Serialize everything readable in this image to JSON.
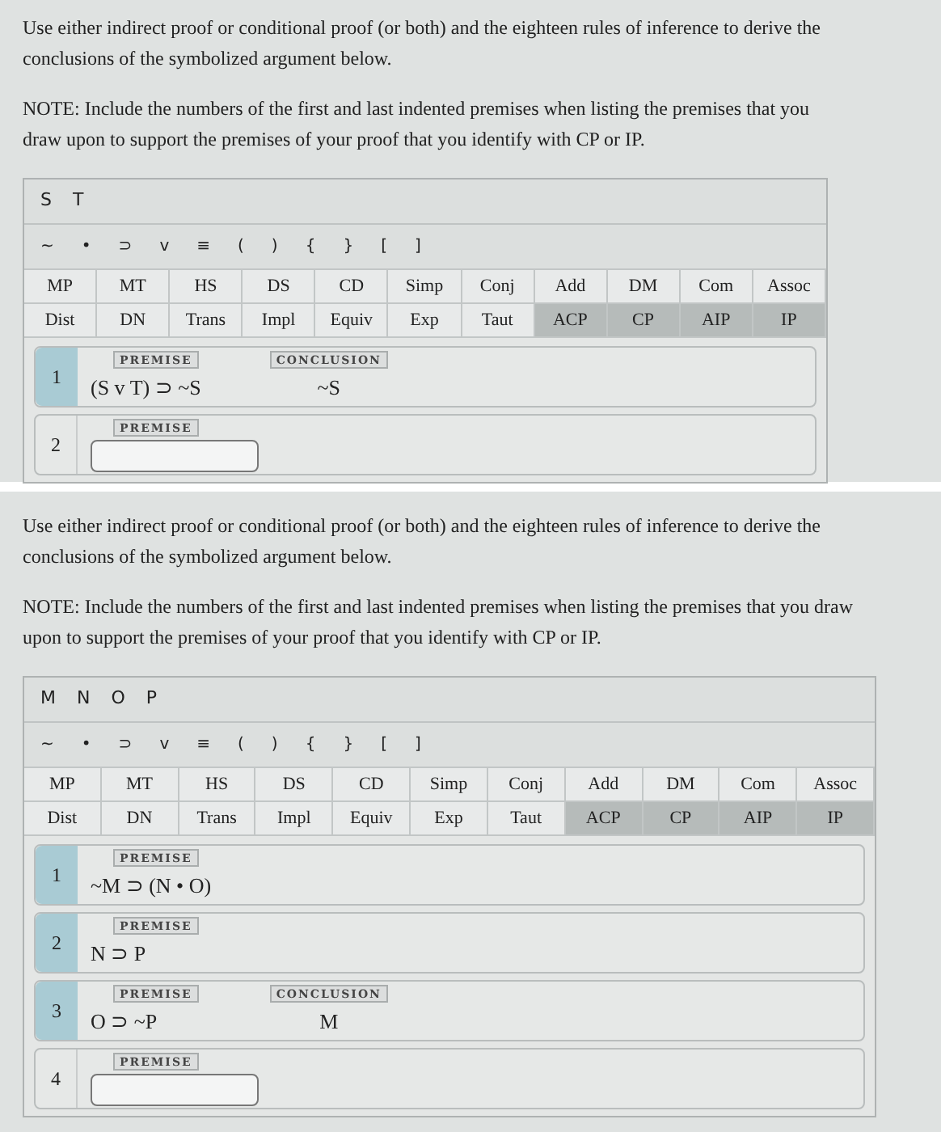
{
  "panels": [
    {
      "instructions": "Use either indirect proof or conditional proof (or both) and the eighteen rules of inference to derive the conclusions of the symbolized argument below.",
      "note": "NOTE: Include the numbers of the first and last indented premises when listing the premises that you draw upon to support the premises of your proof that you identify with CP or IP.",
      "variables": [
        "S",
        "T"
      ],
      "symbols": [
        "~",
        "•",
        "⊃",
        "v",
        "≡",
        "(",
        ")",
        "{",
        "}",
        "[",
        "]"
      ],
      "rules": [
        [
          {
            "label": "MP",
            "kind": "rule"
          },
          {
            "label": "MT",
            "kind": "rule"
          },
          {
            "label": "HS",
            "kind": "rule"
          },
          {
            "label": "DS",
            "kind": "rule"
          },
          {
            "label": "CD",
            "kind": "rule"
          },
          {
            "label": "Simp",
            "kind": "rule"
          },
          {
            "label": "Conj",
            "kind": "rule"
          },
          {
            "label": "Add",
            "kind": "rule"
          },
          {
            "label": "DM",
            "kind": "rule"
          },
          {
            "label": "Com",
            "kind": "rule"
          },
          {
            "label": "Assoc",
            "kind": "rule"
          }
        ],
        [
          {
            "label": "Dist",
            "kind": "rule"
          },
          {
            "label": "DN",
            "kind": "rule"
          },
          {
            "label": "Trans",
            "kind": "rule"
          },
          {
            "label": "Impl",
            "kind": "rule"
          },
          {
            "label": "Equiv",
            "kind": "rule"
          },
          {
            "label": "Exp",
            "kind": "rule"
          },
          {
            "label": "Taut",
            "kind": "rule"
          },
          {
            "label": "ACP",
            "kind": "proof"
          },
          {
            "label": "CP",
            "kind": "proof"
          },
          {
            "label": "AIP",
            "kind": "proof"
          },
          {
            "label": "IP",
            "kind": "proof"
          }
        ]
      ],
      "lines": [
        {
          "number": "1",
          "kind": "given",
          "tag": "PREMISE",
          "formula": "(S v T) ⊃ ~S",
          "conclusion_tag": "CONCLUSION",
          "conclusion": "~S"
        },
        {
          "number": "2",
          "kind": "entry",
          "tag": "PREMISE"
        }
      ]
    },
    {
      "instructions": "Use either indirect proof or conditional proof (or both) and the eighteen rules of inference to derive the conclusions of the symbolized argument below.",
      "note": "NOTE: Include the numbers of the first and last indented premises when listing the premises that you draw upon to support the premises of your proof that you identify with CP or IP.",
      "variables": [
        "M",
        "N",
        "O",
        "P"
      ],
      "symbols": [
        "~",
        "•",
        "⊃",
        "v",
        "≡",
        "(",
        ")",
        "{",
        "}",
        "[",
        "]"
      ],
      "rules": [
        [
          {
            "label": "MP",
            "kind": "rule"
          },
          {
            "label": "MT",
            "kind": "rule"
          },
          {
            "label": "HS",
            "kind": "rule"
          },
          {
            "label": "DS",
            "kind": "rule"
          },
          {
            "label": "CD",
            "kind": "rule"
          },
          {
            "label": "Simp",
            "kind": "rule"
          },
          {
            "label": "Conj",
            "kind": "rule"
          },
          {
            "label": "Add",
            "kind": "rule"
          },
          {
            "label": "DM",
            "kind": "rule"
          },
          {
            "label": "Com",
            "kind": "rule"
          },
          {
            "label": "Assoc",
            "kind": "rule"
          }
        ],
        [
          {
            "label": "Dist",
            "kind": "rule"
          },
          {
            "label": "DN",
            "kind": "rule"
          },
          {
            "label": "Trans",
            "kind": "rule"
          },
          {
            "label": "Impl",
            "kind": "rule"
          },
          {
            "label": "Equiv",
            "kind": "rule"
          },
          {
            "label": "Exp",
            "kind": "rule"
          },
          {
            "label": "Taut",
            "kind": "rule"
          },
          {
            "label": "ACP",
            "kind": "proof"
          },
          {
            "label": "CP",
            "kind": "proof"
          },
          {
            "label": "AIP",
            "kind": "proof"
          },
          {
            "label": "IP",
            "kind": "proof"
          }
        ]
      ],
      "lines": [
        {
          "number": "1",
          "kind": "given",
          "tag": "PREMISE",
          "formula": "~M ⊃ (N • O)"
        },
        {
          "number": "2",
          "kind": "given",
          "tag": "PREMISE",
          "formula": "N ⊃ P"
        },
        {
          "number": "3",
          "kind": "given",
          "tag": "PREMISE",
          "formula": "O ⊃ ~P",
          "conclusion_tag": "CONCLUSION",
          "conclusion": "M"
        },
        {
          "number": "4",
          "kind": "entry",
          "tag": "PREMISE"
        }
      ]
    }
  ]
}
